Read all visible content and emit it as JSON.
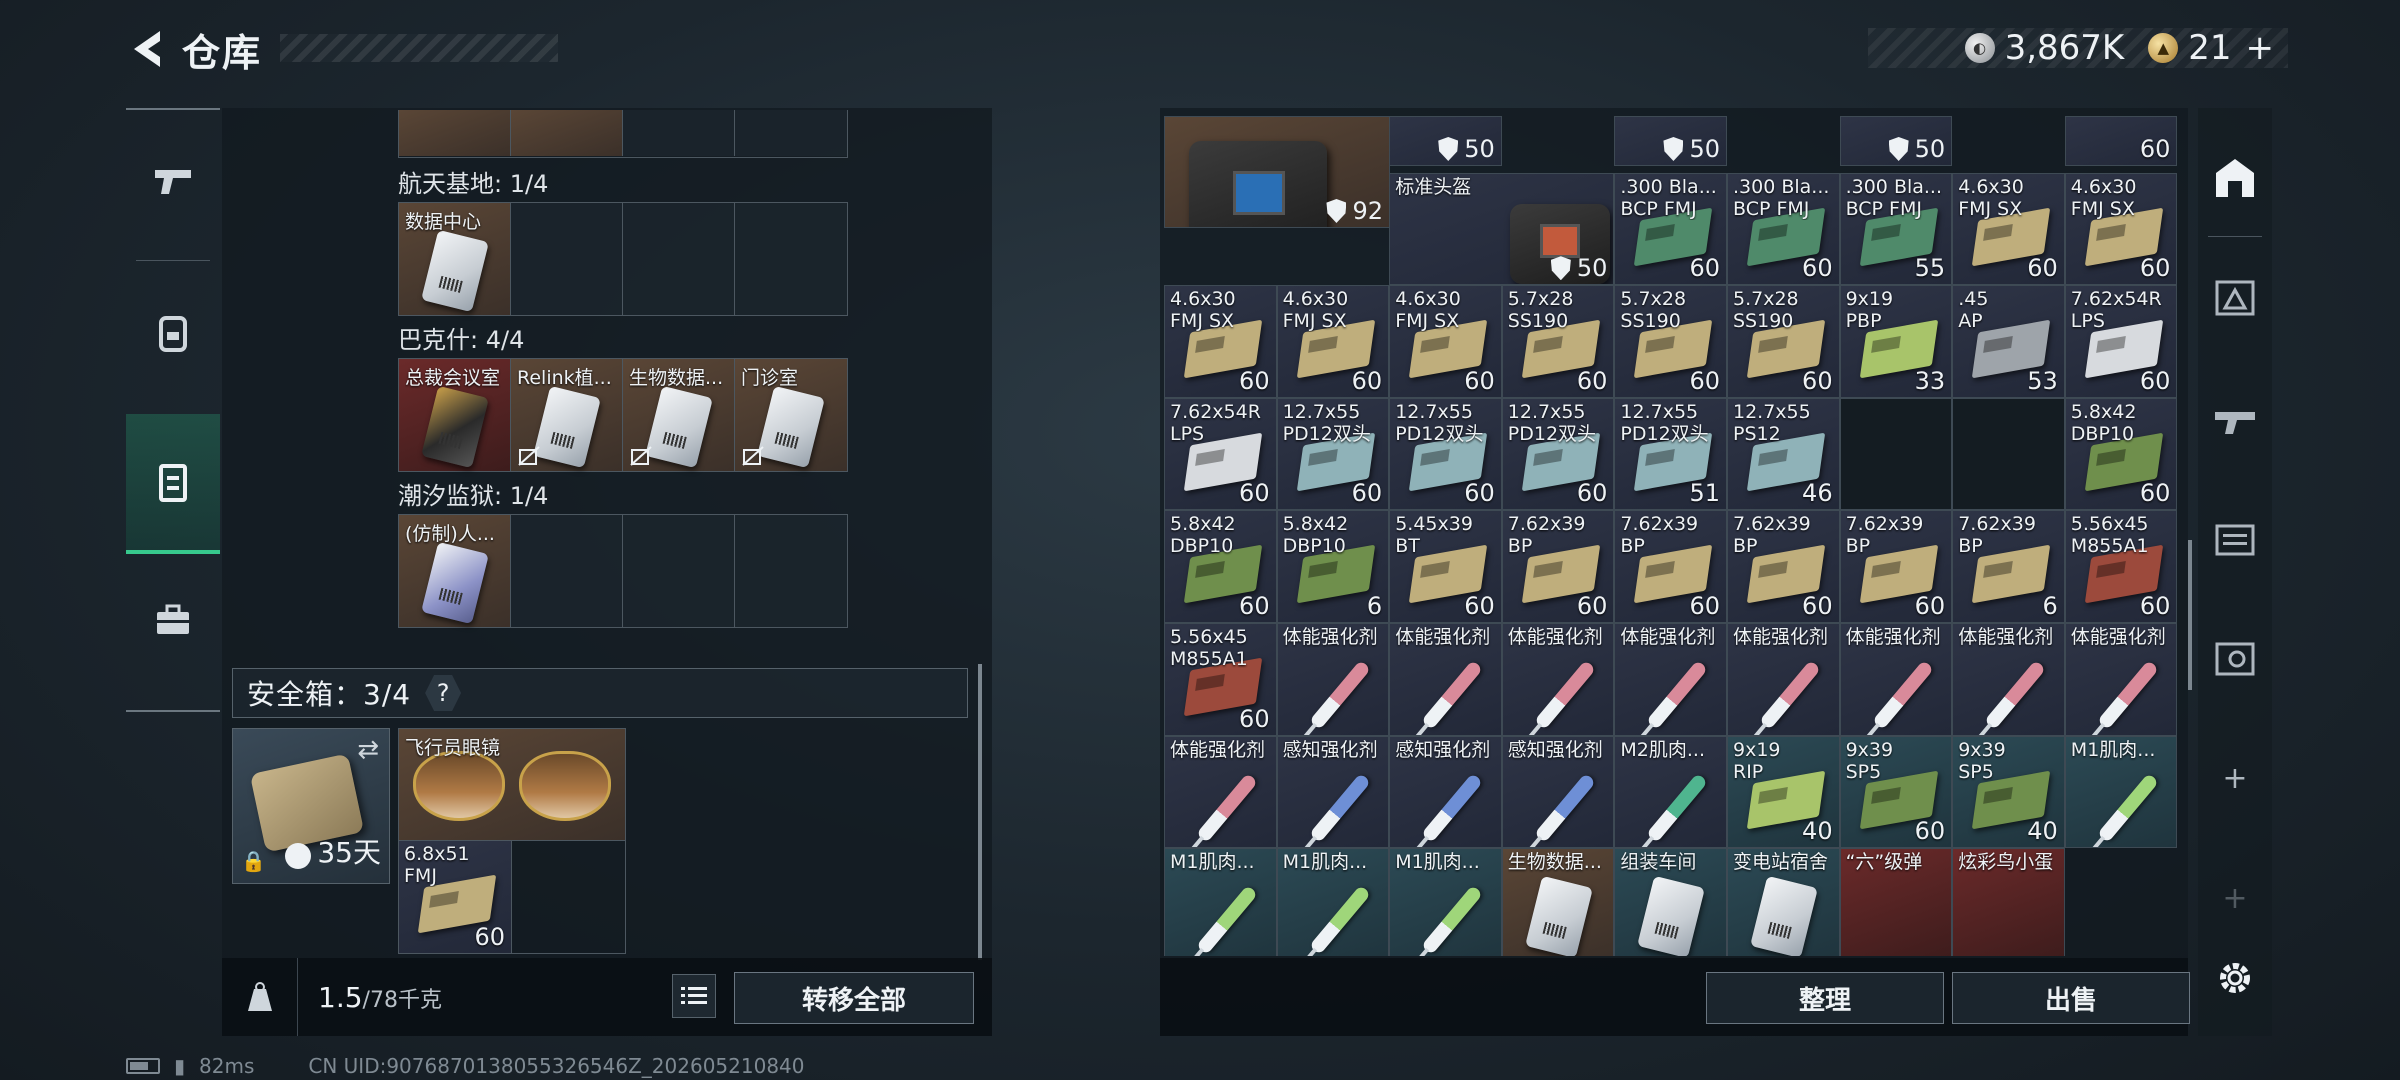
{
  "header": {
    "title": "仓库"
  },
  "currency": {
    "silver_value": "3,867K",
    "gold_value": "21",
    "plus_label": "+"
  },
  "left_rail": {
    "icons": [
      "gun-icon",
      "backpack-icon",
      "container-icon",
      "toolbox-icon"
    ]
  },
  "left_panel": {
    "sections": [
      {
        "title": "航天基地: 1/4",
        "slots": [
          "数据中心",
          "",
          "",
          ""
        ]
      },
      {
        "title": "巴克什: 4/4",
        "slots": [
          "总裁会议室",
          "Relink植...",
          "生物数据...",
          "门诊室"
        ]
      },
      {
        "title": "潮汐监狱: 1/4",
        "slots": [
          "(仿制)人...",
          "",
          "",
          ""
        ]
      }
    ],
    "safebox": {
      "label": "安全箱：3/4",
      "help": "?",
      "days": "35天",
      "items": [
        {
          "name": "飞行员眼镜"
        },
        {
          "name": "6.8x51\nFMJ",
          "qty": "60"
        }
      ]
    },
    "footer": {
      "weight_current": "1.5",
      "weight_max": "/78千克",
      "transfer_label": "转移全部"
    }
  },
  "right_panel": {
    "cells": [
      {
        "name": "",
        "qty": "50",
        "shield": true,
        "color": "navy"
      },
      {
        "name": "",
        "qty": "50",
        "shield": true,
        "color": "navy"
      },
      {
        "name": "",
        "qty": "50",
        "shield": true,
        "color": "navy"
      },
      {
        "name": "",
        "qty": "60",
        "color": "navy"
      },
      {
        "name": "标准头盔",
        "qty": "50",
        "shield": true,
        "color": "navy"
      },
      {
        "name": ".300 Bla...\nBCP FMJ",
        "qty": "60",
        "color": "navy",
        "box": "#4f8a6a"
      },
      {
        "name": ".300 Bla...\nBCP FMJ",
        "qty": "60",
        "color": "navy",
        "box": "#4f8a6a"
      },
      {
        "name": ".300 Bla...\nBCP FMJ",
        "qty": "55",
        "color": "navy",
        "box": "#4f8a6a"
      },
      {
        "name": "4.6x30\nFMJ SX",
        "qty": "60",
        "color": "navy",
        "box": "#bfae7c"
      },
      {
        "name": "4.6x30\nFMJ SX",
        "qty": "60",
        "color": "navy",
        "box": "#bfae7c"
      },
      {
        "name": "4.6x30\nFMJ SX",
        "qty": "60",
        "color": "navy",
        "box": "#bfae7c"
      },
      {
        "name": "4.6x30\nFMJ SX",
        "qty": "60",
        "color": "navy",
        "box": "#bfae7c"
      },
      {
        "name": "4.6x30\nFMJ SX",
        "qty": "60",
        "color": "navy",
        "box": "#bfae7c"
      },
      {
        "name": "5.7x28\nSS190",
        "qty": "60",
        "color": "navy",
        "box": "#bfae7c"
      },
      {
        "name": "5.7x28\nSS190",
        "qty": "60",
        "color": "navy",
        "box": "#bfae7c"
      },
      {
        "name": "5.7x28\nSS190",
        "qty": "60",
        "color": "navy",
        "box": "#bfae7c"
      },
      {
        "name": "9x19\nPBP",
        "qty": "33",
        "color": "navy",
        "box": "#a8c46a"
      },
      {
        "name": ".45\nAP",
        "qty": "53",
        "color": "navy",
        "box": "#9ea4aa"
      },
      {
        "name": "7.62x54R\nLPS",
        "qty": "60",
        "color": "navy",
        "box": "#d7dade"
      },
      {
        "name": "7.62x54R\nLPS",
        "qty": "60",
        "color": "navy",
        "box": "#d7dade"
      },
      {
        "name": "12.7x55\nPD12双头",
        "qty": "60",
        "color": "navy",
        "box": "#8fb2b8"
      },
      {
        "name": "12.7x55\nPD12双头",
        "qty": "60",
        "color": "navy",
        "box": "#8fb2b8"
      },
      {
        "name": "12.7x55\nPD12双头",
        "qty": "60",
        "color": "navy",
        "box": "#8fb2b8"
      },
      {
        "name": "12.7x55\nPD12双头",
        "qty": "51",
        "color": "navy",
        "box": "#8fb2b8"
      },
      {
        "name": "12.7x55\nPS12",
        "qty": "46",
        "color": "navy",
        "box": "#8fb2b8"
      },
      {
        "name": "",
        "qty": "",
        "color": "empty"
      },
      {
        "name": "",
        "qty": "",
        "color": "empty"
      },
      {
        "name": "5.8x42\nDBP10",
        "qty": "60",
        "color": "navy",
        "box": "#6f8f4c"
      },
      {
        "name": "5.8x42\nDBP10",
        "qty": "60",
        "color": "navy",
        "box": "#6f8f4c"
      },
      {
        "name": "5.8x42\nDBP10",
        "qty": "6",
        "color": "navy",
        "box": "#6f8f4c"
      },
      {
        "name": "5.45x39\nBT",
        "qty": "60",
        "color": "navy",
        "box": "#bfae7c"
      },
      {
        "name": "7.62x39\nBP",
        "qty": "60",
        "color": "navy",
        "box": "#bfae7c"
      },
      {
        "name": "7.62x39\nBP",
        "qty": "60",
        "color": "navy",
        "box": "#bfae7c"
      },
      {
        "name": "7.62x39\nBP",
        "qty": "60",
        "color": "navy",
        "box": "#bfae7c"
      },
      {
        "name": "7.62x39\nBP",
        "qty": "60",
        "color": "navy",
        "box": "#bfae7c"
      },
      {
        "name": "7.62x39\nBP",
        "qty": "6",
        "color": "navy",
        "box": "#bfae7c"
      },
      {
        "name": "5.56x45\nM855A1",
        "qty": "60",
        "color": "navy",
        "box": "#9c4a3c"
      },
      {
        "name": "5.56x45\nM855A1",
        "qty": "60",
        "color": "navy",
        "box": "#9c4a3c"
      },
      {
        "name": "体能强化剂",
        "qty": "",
        "color": "navy",
        "syringe": "#d98a9a"
      },
      {
        "name": "体能强化剂",
        "qty": "",
        "color": "navy",
        "syringe": "#d98a9a"
      },
      {
        "name": "体能强化剂",
        "qty": "",
        "color": "navy",
        "syringe": "#d98a9a"
      },
      {
        "name": "体能强化剂",
        "qty": "",
        "color": "navy",
        "syringe": "#d98a9a"
      },
      {
        "name": "体能强化剂",
        "qty": "",
        "color": "navy",
        "syringe": "#d98a9a"
      },
      {
        "name": "体能强化剂",
        "qty": "",
        "color": "navy",
        "syringe": "#d98a9a"
      },
      {
        "name": "体能强化剂",
        "qty": "",
        "color": "navy",
        "syringe": "#d98a9a"
      },
      {
        "name": "体能强化剂",
        "qty": "",
        "color": "navy",
        "syringe": "#d98a9a"
      },
      {
        "name": "体能强化剂",
        "qty": "",
        "color": "navy",
        "syringe": "#d98a9a"
      },
      {
        "name": "感知强化剂",
        "qty": "",
        "color": "navy",
        "syringe": "#6e8fd6"
      },
      {
        "name": "感知强化剂",
        "qty": "",
        "color": "navy",
        "syringe": "#6e8fd6"
      },
      {
        "name": "感知强化剂",
        "qty": "",
        "color": "navy",
        "syringe": "#6e8fd6"
      },
      {
        "name": "M2肌肉...",
        "qty": "",
        "color": "navy",
        "syringe": "#4fb58f"
      },
      {
        "name": "9x19\nRIP",
        "qty": "40",
        "color": "teal",
        "box": "#a8c46a"
      },
      {
        "name": "9x39\nSP5",
        "qty": "60",
        "color": "teal",
        "box": "#6f8f4c"
      },
      {
        "name": "9x39\nSP5",
        "qty": "40",
        "color": "teal",
        "box": "#6f8f4c"
      },
      {
        "name": "M1肌肉...",
        "qty": "",
        "color": "teal",
        "syringe": "#9fd67a"
      },
      {
        "name": "M1肌肉...",
        "qty": "",
        "color": "teal",
        "syringe": "#9fd67a"
      },
      {
        "name": "M1肌肉...",
        "qty": "",
        "color": "teal",
        "syringe": "#9fd67a"
      },
      {
        "name": "M1肌肉...",
        "qty": "",
        "color": "teal",
        "syringe": "#9fd67a"
      },
      {
        "name": "生物数据...",
        "qty": "",
        "color": "brown",
        "card": true
      },
      {
        "name": "组装车间",
        "qty": "",
        "color": "teal",
        "card": true
      },
      {
        "name": "变电站宿舍",
        "qty": "",
        "color": "teal",
        "card": true
      },
      {
        "name": "“六”级弹",
        "qty": "",
        "color": "red"
      },
      {
        "name": "炫彩鸟小蛋",
        "qty": "",
        "color": "red"
      }
    ],
    "footer": {
      "sort_label": "整理",
      "sell_label": "出售"
    }
  },
  "status": {
    "ping": "82ms",
    "uid": "CN UID:9076870138055326546Z_202605210840"
  }
}
